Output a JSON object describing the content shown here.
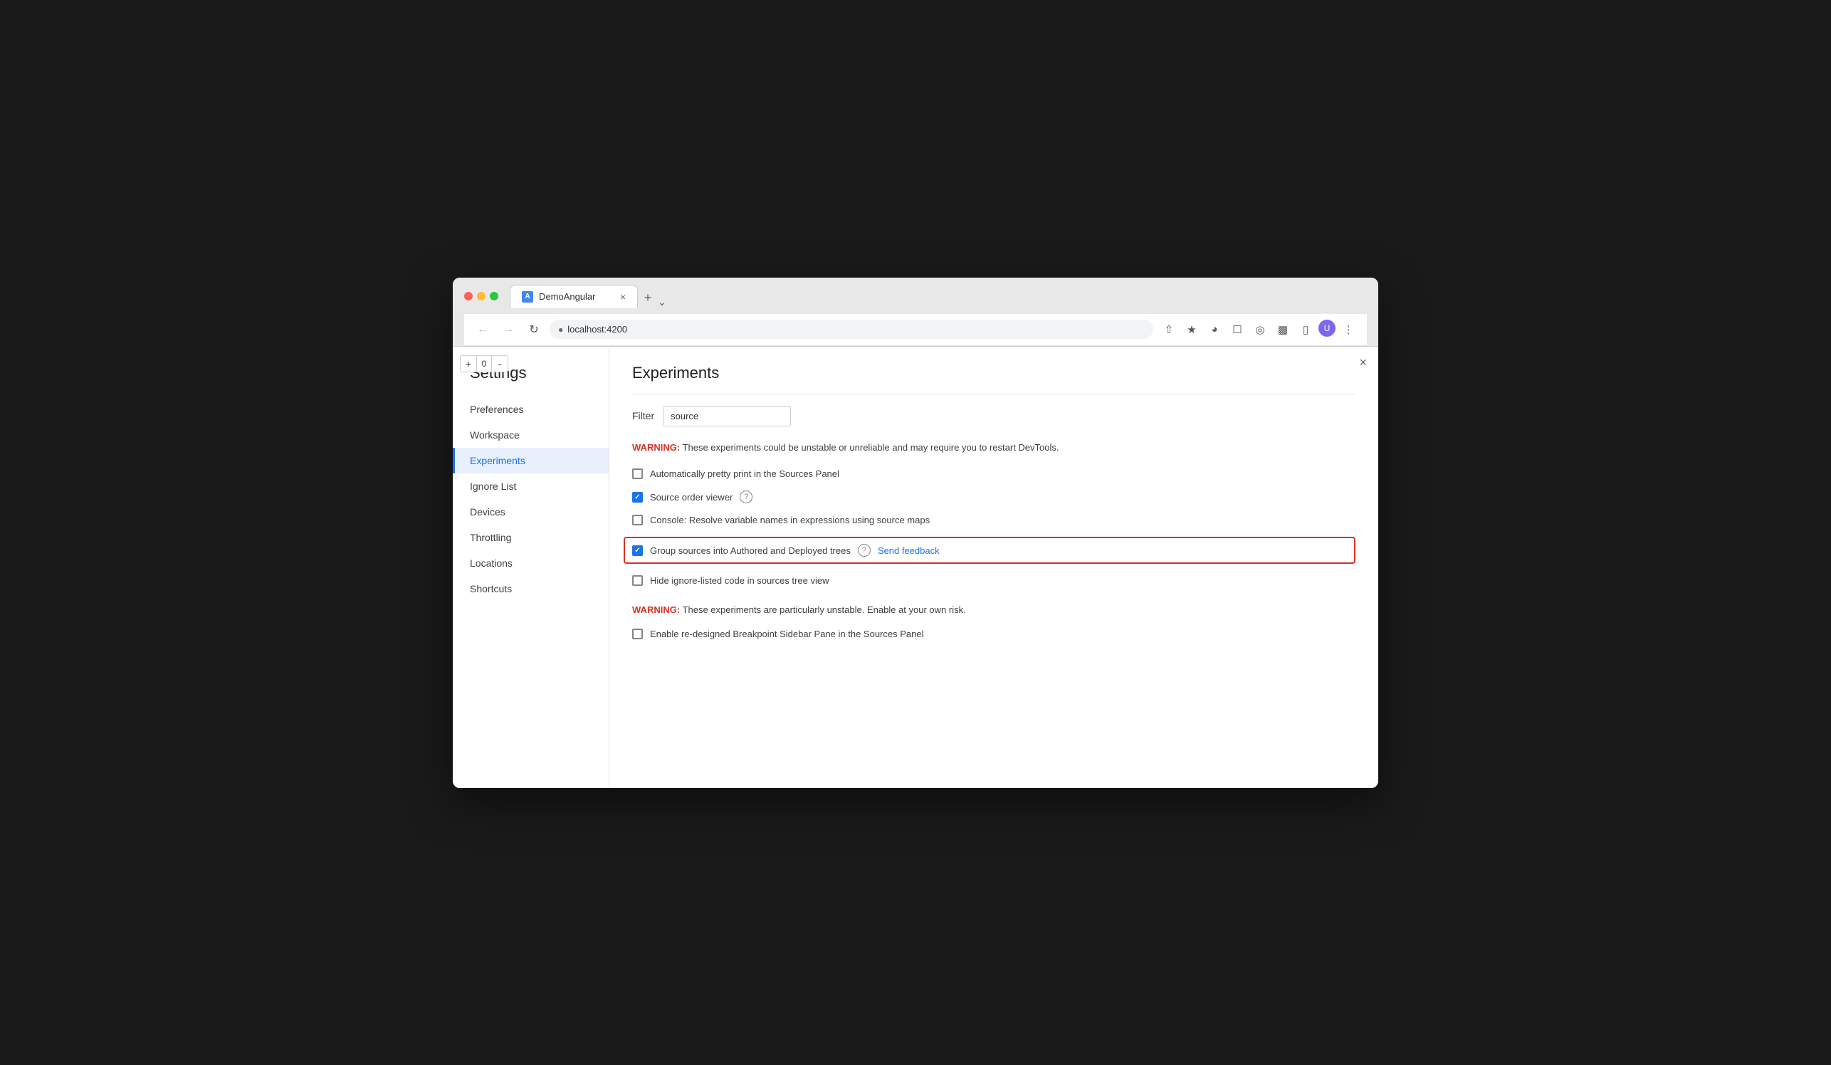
{
  "browser": {
    "tab_title": "DemoAngular",
    "tab_close": "×",
    "tab_new": "+",
    "address": "localhost:4200",
    "window_close": "×",
    "dropdown_arrow": "⌄"
  },
  "devtools_counter": {
    "plus": "+",
    "value": "0",
    "minus": "-"
  },
  "settings": {
    "title": "Settings",
    "sidebar_items": [
      {
        "id": "preferences",
        "label": "Preferences",
        "active": false
      },
      {
        "id": "workspace",
        "label": "Workspace",
        "active": false
      },
      {
        "id": "experiments",
        "label": "Experiments",
        "active": true
      },
      {
        "id": "ignore-list",
        "label": "Ignore List",
        "active": false
      },
      {
        "id": "devices",
        "label": "Devices",
        "active": false
      },
      {
        "id": "throttling",
        "label": "Throttling",
        "active": false
      },
      {
        "id": "locations",
        "label": "Locations",
        "active": false
      },
      {
        "id": "shortcuts",
        "label": "Shortcuts",
        "active": false
      }
    ]
  },
  "experiments": {
    "title": "Experiments",
    "filter_label": "Filter",
    "filter_value": "source",
    "filter_placeholder": "Filter",
    "warning1_prefix": "WARNING:",
    "warning1_text": " These experiments could be unstable or unreliable and may require you to restart DevTools.",
    "items": [
      {
        "id": "pretty-print",
        "label": "Automatically pretty print in the Sources Panel",
        "checked": false,
        "highlighted": false,
        "has_help": false,
        "has_feedback": false
      },
      {
        "id": "source-order-viewer",
        "label": "Source order viewer",
        "checked": true,
        "highlighted": false,
        "has_help": true,
        "has_feedback": false
      },
      {
        "id": "console-source-maps",
        "label": "Console: Resolve variable names in expressions using source maps",
        "checked": false,
        "highlighted": false,
        "has_help": false,
        "has_feedback": false
      },
      {
        "id": "group-sources",
        "label": "Group sources into Authored and Deployed trees",
        "checked": true,
        "highlighted": true,
        "has_help": true,
        "has_feedback": true,
        "feedback_label": "Send feedback"
      },
      {
        "id": "hide-ignore-listed",
        "label": "Hide ignore-listed code in sources tree view",
        "checked": false,
        "highlighted": false,
        "has_help": false,
        "has_feedback": false
      }
    ],
    "warning2_prefix": "WARNING:",
    "warning2_text": " These experiments are particularly unstable. Enable at your own risk.",
    "unstable_items": [
      {
        "id": "breakpoint-sidebar",
        "label": "Enable re-designed Breakpoint Sidebar Pane in the Sources Panel",
        "checked": false
      }
    ],
    "help_icon_label": "?",
    "question_mark": "?"
  }
}
